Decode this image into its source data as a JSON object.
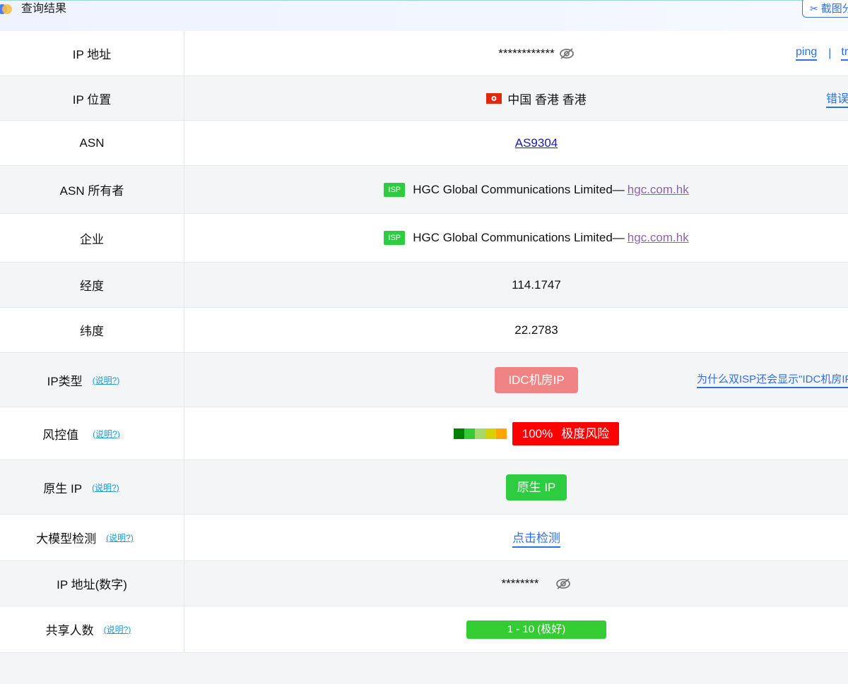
{
  "header": {
    "title": "查询结果",
    "screenshot_button": "截图分享"
  },
  "rows": {
    "ip_address": {
      "label": "IP 地址",
      "value": "************",
      "links": [
        "ping",
        "|",
        "tr"
      ]
    },
    "ip_location": {
      "label": "IP 位置",
      "value": "中国 香港 香港",
      "right_link": "错误"
    },
    "asn": {
      "label": "ASN",
      "value": "AS9304"
    },
    "asn_owner": {
      "label": "ASN 所有者",
      "badge": "ISP",
      "value": "HGC Global Communications Limited—",
      "domain": "hgc.com.hk"
    },
    "enterprise": {
      "label": "企业",
      "badge": "ISP",
      "value": "HGC Global Communications Limited—",
      "domain": "hgc.com.hk"
    },
    "longitude": {
      "label": "经度",
      "value": "114.1747"
    },
    "latitude": {
      "label": "纬度",
      "value": "22.2783"
    },
    "ip_type": {
      "label": "IP类型",
      "help": "(说明?)",
      "value": "IDC机房IP",
      "right_link": "为什么双ISP还会显示\"IDC机房IP"
    },
    "risk": {
      "label": "风控值",
      "help": "(说明?)",
      "percent": "100%",
      "level": "极度风险",
      "risk_colors": [
        "#008000",
        "#33cc33",
        "#a6d96a",
        "#d4d400",
        "#ffa500"
      ]
    },
    "native_ip": {
      "label": "原生 IP",
      "help": "(说明?)",
      "value": "原生 IP"
    },
    "llm_detect": {
      "label": "大模型检测",
      "help": "(说明?)",
      "value": "点击检测"
    },
    "ip_numeric": {
      "label": "IP 地址(数字)",
      "value": "********"
    },
    "shared_users": {
      "label": "共享人数",
      "help": "(说明?)",
      "value": "1 - 10 (极好)"
    }
  },
  "colors": {
    "accent_blue": "#2f6fe4",
    "isp_green": "#2ecc40",
    "risk_red": "#ff0000",
    "idc_pink": "#f08484"
  }
}
